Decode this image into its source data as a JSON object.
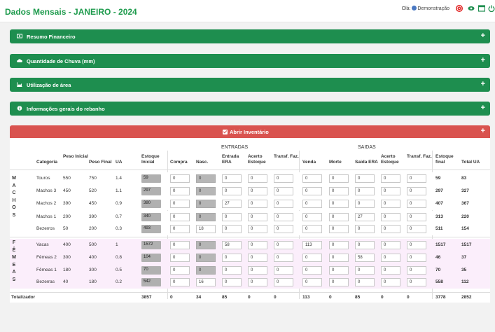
{
  "header": {
    "title": "Dados Mensais - JANEIRO - 2024",
    "greeting": "Olá:",
    "user": "Demonstração"
  },
  "panels": [
    {
      "label": "Resumo Financeiro",
      "icon": "money-icon"
    },
    {
      "label": "Quantidade de Chuva (mm)",
      "icon": "cloud-icon"
    },
    {
      "label": "Utilização de área",
      "icon": "area-chart-icon"
    },
    {
      "label": "Informações gerais do rebanho",
      "icon": "info-icon"
    }
  ],
  "inventory_button": "Abrir Inventário",
  "plus": "+",
  "table": {
    "groups": {
      "entradas": "ENTRADAS",
      "saidas": "SAIDAS"
    },
    "headers": {
      "categoria": "Categoria",
      "peso_inicial": "Peso Inicial",
      "peso_final": "Peso Final",
      "ua": "UA",
      "estoque_inicial": "Estoque Inicial",
      "compra": "Compra",
      "nasc": "Nasc.",
      "entrada_era": "Entrada ERA",
      "acerto_estoque_in": "Acerto Estoque",
      "transf_faz_in": "Transf. Faz.",
      "venda": "Venda",
      "morte": "Morte",
      "saida_era": "Saida ERA",
      "acerto_estoque_out": "Acerto Estoque",
      "transf_faz_out": "Transf. Faz.",
      "estoque_final": "Estoque final",
      "total_ua": "Total UA"
    },
    "machos_label": [
      "M",
      "A",
      "C",
      "H",
      "O",
      "S"
    ],
    "femeas_label": [
      "F",
      "Ê",
      "M",
      "E",
      "A",
      "S"
    ],
    "rows": [
      {
        "cat": "Touros",
        "pi": "550",
        "pf": "750",
        "ua": "1.4",
        "ei": "59",
        "compra": "0",
        "nasc": "0",
        "ent_era": "0",
        "ac_in": "0",
        "tf_in": "0",
        "venda": "0",
        "morte": "0",
        "saida_era": "0",
        "ac_out": "0",
        "tf_out": "0",
        "ef": "59",
        "tua": "83"
      },
      {
        "cat": "Machos 3",
        "pi": "450",
        "pf": "520",
        "ua": "1.1",
        "ei": "297",
        "compra": "0",
        "nasc": "0",
        "ent_era": "0",
        "ac_in": "0",
        "tf_in": "0",
        "venda": "0",
        "morte": "0",
        "saida_era": "0",
        "ac_out": "0",
        "tf_out": "0",
        "ef": "297",
        "tua": "327"
      },
      {
        "cat": "Machos 2",
        "pi": "390",
        "pf": "450",
        "ua": "0.9",
        "ei": "380",
        "compra": "0",
        "nasc": "0",
        "ent_era": "27",
        "ac_in": "0",
        "tf_in": "0",
        "venda": "0",
        "morte": "0",
        "saida_era": "0",
        "ac_out": "0",
        "tf_out": "0",
        "ef": "407",
        "tua": "367"
      },
      {
        "cat": "Machos 1",
        "pi": "200",
        "pf": "390",
        "ua": "0.7",
        "ei": "340",
        "compra": "0",
        "nasc": "0",
        "ent_era": "0",
        "ac_in": "0",
        "tf_in": "0",
        "venda": "0",
        "morte": "0",
        "saida_era": "27",
        "ac_out": "0",
        "tf_out": "0",
        "ef": "313",
        "tua": "220"
      },
      {
        "cat": "Bezerros",
        "pi": "50",
        "pf": "200",
        "ua": "0.3",
        "ei": "493",
        "compra": "0",
        "nasc": "18",
        "ent_era": "0",
        "ac_in": "0",
        "tf_in": "0",
        "venda": "0",
        "morte": "0",
        "saida_era": "0",
        "ac_out": "0",
        "tf_out": "0",
        "ef": "511",
        "tua": "154"
      },
      {
        "cat": "Vacas",
        "pi": "400",
        "pf": "500",
        "ua": "1",
        "ei": "1572",
        "compra": "0",
        "nasc": "0",
        "ent_era": "58",
        "ac_in": "0",
        "tf_in": "0",
        "venda": "113",
        "morte": "0",
        "saida_era": "0",
        "ac_out": "0",
        "tf_out": "0",
        "ef": "1517",
        "tua": "1517"
      },
      {
        "cat": "Fêmeas 2",
        "pi": "300",
        "pf": "400",
        "ua": "0.8",
        "ei": "104",
        "compra": "0",
        "nasc": "0",
        "ent_era": "0",
        "ac_in": "0",
        "tf_in": "0",
        "venda": "0",
        "morte": "0",
        "saida_era": "58",
        "ac_out": "0",
        "tf_out": "0",
        "ef": "46",
        "tua": "37"
      },
      {
        "cat": "Fêmeas 1",
        "pi": "180",
        "pf": "300",
        "ua": "0.5",
        "ei": "70",
        "compra": "0",
        "nasc": "0",
        "ent_era": "0",
        "ac_in": "0",
        "tf_in": "0",
        "venda": "0",
        "morte": "0",
        "saida_era": "0",
        "ac_out": "0",
        "tf_out": "0",
        "ef": "70",
        "tua": "35"
      },
      {
        "cat": "Bezerras",
        "pi": "40",
        "pf": "180",
        "ua": "0.2",
        "ei": "542",
        "compra": "0",
        "nasc": "16",
        "ent_era": "0",
        "ac_in": "0",
        "tf_in": "0",
        "venda": "0",
        "morte": "0",
        "saida_era": "0",
        "ac_out": "0",
        "tf_out": "0",
        "ef": "558",
        "tua": "112"
      }
    ],
    "totals": {
      "label": "Totalizador",
      "ei": "3857",
      "compra": "0",
      "nasc": "34",
      "ent_era": "85",
      "ac_in": "0",
      "tf_in": "0",
      "venda": "113",
      "morte": "0",
      "saida_era": "85",
      "ac_out": "0",
      "tf_out": "0",
      "ef": "3778",
      "tua": "2852"
    }
  },
  "colors": {
    "green": "#1e8e4f",
    "title_green": "#1e9b4d",
    "red": "#d9534f"
  }
}
